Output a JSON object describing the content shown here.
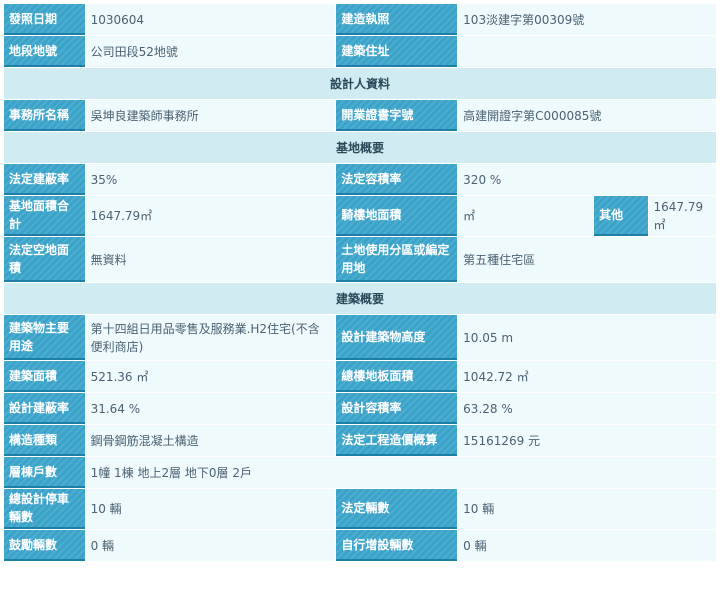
{
  "rows": {
    "permit_date": {
      "label": "發照日期",
      "value": "1030604"
    },
    "build_license": {
      "label": "建造執照",
      "value": "103淡建字第00309號"
    },
    "lot_number": {
      "label": "地段地號",
      "value": "公司田段52地號"
    },
    "build_address": {
      "label": "建築住址",
      "value": ""
    },
    "designer_section": "設計人資料",
    "office_name": {
      "label": "事務所名稱",
      "value": "吳坤良建築師事務所"
    },
    "license_no": {
      "label": "開業證書字號",
      "value": "高建開證字第C000085號"
    },
    "site_section": "基地概要",
    "legal_coverage": {
      "label": "法定建蔽率",
      "value": "35%"
    },
    "legal_far": {
      "label": "法定容積率",
      "value": "320 %"
    },
    "site_area_total": {
      "label": "基地面積合計",
      "value": "1647.79㎡"
    },
    "arcade_area": {
      "label": "騎樓地面積",
      "value": "㎡"
    },
    "other": {
      "label": "其他",
      "value": "1647.79㎡"
    },
    "legal_open_area": {
      "label": "法定空地面積",
      "value": "無資料"
    },
    "land_use_zone": {
      "label": "土地使用分區或編定用地",
      "value": "第五種住宅區"
    },
    "building_section": "建築概要",
    "main_use": {
      "label": "建築物主要用途",
      "value": "第十四組日用品零售及服務業.H2住宅(不含便利商店)"
    },
    "design_height": {
      "label": "設計建築物高度",
      "value": "10.05 m"
    },
    "building_area": {
      "label": "建築面積",
      "value": "521.36 ㎡"
    },
    "total_floor_area": {
      "label": "總樓地板面積",
      "value": "1042.72 ㎡"
    },
    "design_coverage": {
      "label": "設計建蔽率",
      "value": "31.64 %"
    },
    "design_far": {
      "label": "設計容積率",
      "value": "63.28 %"
    },
    "structure_type": {
      "label": "構造種類",
      "value": "鋼骨鋼筋混凝土構造"
    },
    "legal_cost": {
      "label": "法定工程造價概算",
      "value": "15161269 元"
    },
    "floors_units": {
      "label": "層棟戶數",
      "value": "1幢 1棟 地上2層 地下0層 2戶"
    },
    "total_parking": {
      "label": "總設計停車輛數",
      "value": "10 輛"
    },
    "legal_parking": {
      "label": "法定輛數",
      "value": "10 輛"
    },
    "incentive_parking": {
      "label": "鼓勵輛數",
      "value": "0 輛"
    },
    "self_added_parking": {
      "label": "自行增設輛數",
      "value": "0 輛"
    }
  }
}
